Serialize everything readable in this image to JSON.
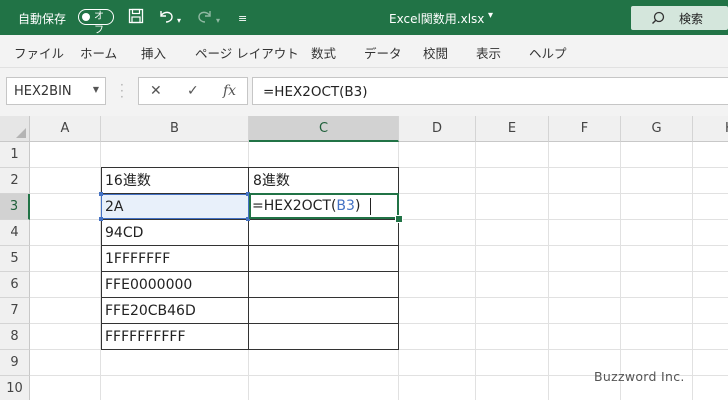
{
  "titlebar": {
    "autosave_label": "自動保存",
    "autosave_state": "オフ",
    "filename": "Excel関数用.xlsx",
    "filename_dropdown": "▾",
    "search_label": "検索"
  },
  "ribbon": {
    "tabs": [
      "ファイル",
      "ホーム",
      "挿入",
      "ページ レイアウト",
      "数式",
      "データ",
      "校閲",
      "表示",
      "ヘルプ"
    ]
  },
  "formula_bar": {
    "name_box": "HEX2BIN",
    "cancel_glyph": "✕",
    "enter_glyph": "✓",
    "fx_glyph": "fx",
    "formula": "=HEX2OCT(B3)"
  },
  "grid": {
    "columns": [
      "A",
      "B",
      "C",
      "D",
      "E",
      "F",
      "G",
      "H"
    ],
    "rows": [
      "1",
      "2",
      "3",
      "4",
      "5",
      "6",
      "7",
      "8",
      "9",
      "10"
    ],
    "selected_column": "C",
    "selected_row": "3",
    "table": {
      "header_b": "16進数",
      "header_c": "8進数",
      "values": [
        "2A",
        "94CD",
        "1FFFFFFF",
        "FFE0000000",
        "FFE20CB46D",
        "FFFFFFFFFF"
      ]
    },
    "edit_cell": {
      "prefix": "=HEX2OCT(",
      "ref": "B3",
      "suffix": ")"
    }
  },
  "watermark": "Buzzword Inc.",
  "colors": {
    "excel_green": "#217346",
    "ref_blue": "#4472c4"
  }
}
